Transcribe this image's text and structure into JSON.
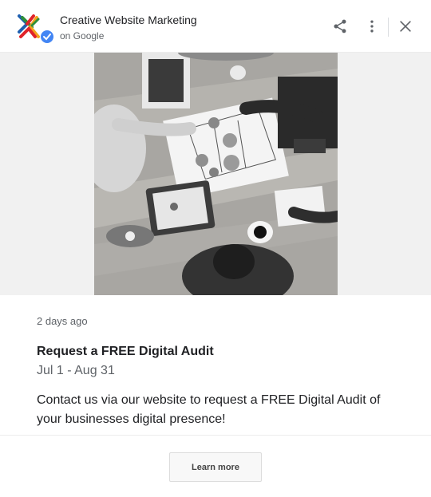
{
  "header": {
    "business_name": "Creative Website Marketing",
    "source": "on Google",
    "logo_icon": "verified-business-logo-icon",
    "share_icon": "share-icon",
    "more_icon": "more-vert-icon",
    "close_icon": "close-icon"
  },
  "media": {
    "image_icon": "business-meeting-photo"
  },
  "post": {
    "age": "2 days ago",
    "title": "Request a FREE Digital Audit",
    "dates": "Jul 1 - Aug 31",
    "body": "Contact us via our website to request a FREE Digital Audit of your businesses digital presence!"
  },
  "footer": {
    "cta_label": "Learn more"
  },
  "colors": {
    "title": "#202124",
    "muted": "#5f6368",
    "verified_badge": "#4285f4"
  }
}
